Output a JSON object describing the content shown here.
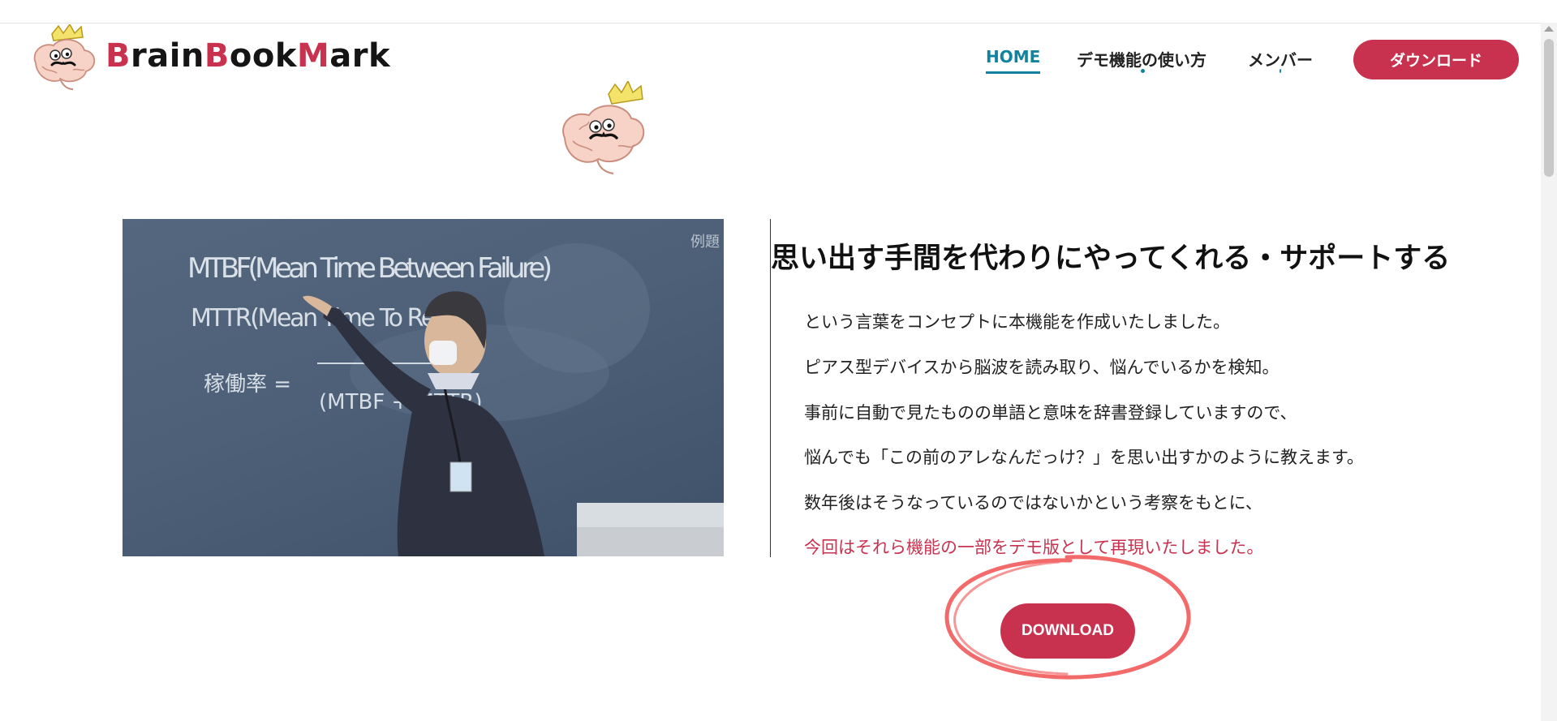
{
  "header": {
    "brand": {
      "b1": "B",
      "r1": "rain",
      "b2": "B",
      "r2": "ook",
      "b3": "M",
      "r3": "ark"
    },
    "nav": [
      {
        "label": "HOME",
        "active": true
      },
      {
        "label": "デモ機能の使い方"
      },
      {
        "label": "メンバー"
      }
    ],
    "download_label": "ダウンロード"
  },
  "main": {
    "headline": "思い出す手間を代わりにやってくれる・サポートする",
    "paragraphs": [
      "という言葉をコンセプトに本機能を作成いたしました。",
      "ピアス型デバイスから脳波を読み取り、悩んでいるかを検知。",
      "事前に自動で見たものの単語と意味を辞書登録していますので、",
      "悩んでも「この前のアレなんだっけ？」を思い出すかのように教えます。",
      "数年後はそうなっているのではないかという考察をもとに、",
      "今回はそれら機能の一部をデモ版として再現いたしました。"
    ],
    "download_button": "DOWNLOAD",
    "photo": {
      "board_lines": [
        "MTBF(Mean Time Between Failure)",
        "MTTR(Mean Time To Repair)",
        "稼働率 =",
        "(MTBF + MTTR)",
        "例題"
      ]
    }
  },
  "colors": {
    "accent": "#c8324f",
    "nav_active": "#11839e",
    "annotation": "#f26a6a"
  },
  "icons": [
    "brain-mascot-logo-icon",
    "brain-mascot-icon",
    "scroll-up-arrow-icon"
  ]
}
